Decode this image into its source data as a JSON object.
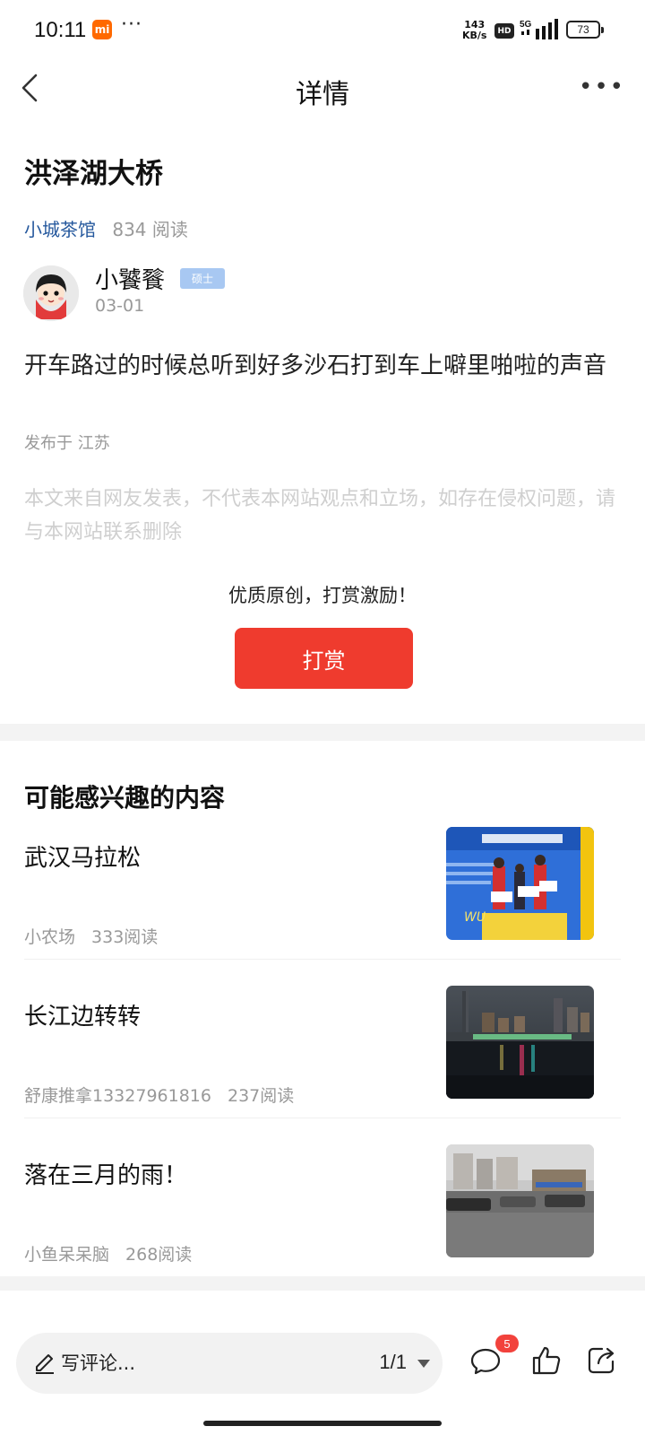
{
  "status_bar": {
    "time": "10:11",
    "mi_label": "mi",
    "dots": "···",
    "net_speed_value": "143",
    "net_speed_unit": "KB/s",
    "hd_label": "HD",
    "network": "5G",
    "battery": "73"
  },
  "header": {
    "title": "详情"
  },
  "article": {
    "title": "洪泽湖大桥",
    "forum": "小城茶馆",
    "reads": "834 阅读",
    "author": {
      "name": "小饕餮",
      "badge": "硕士",
      "date": "03-01"
    },
    "body": "开车路过的时候总听到好多沙石打到车上噼里啪啦的声音",
    "location": "发布于 江苏",
    "disclaimer": "本文来自网友发表，不代表本网站观点和立场，如存在侵权问题，请与本网站联系删除"
  },
  "reward": {
    "prompt": "优质原创，打赏激励！",
    "button_label": "打赏"
  },
  "recommendations": {
    "header": "可能感兴趣的内容",
    "items": [
      {
        "title": "武汉马拉松",
        "source": "小农场",
        "reads": "333阅读",
        "thumb": "marathon-podium-photo"
      },
      {
        "title": "长江边转转",
        "source": "舒康推拿13327961816",
        "reads": "237阅读",
        "thumb": "river-night-photo"
      },
      {
        "title": "落在三月的雨！",
        "source": "小鱼呆呆脑",
        "reads": "268阅读",
        "thumb": "rainy-street-photo"
      }
    ]
  },
  "bottom_bar": {
    "comment_placeholder": "写评论...",
    "page_indicator": "1/1",
    "comment_count": "5"
  },
  "colors": {
    "accent_red": "#ef3b2e",
    "forum_blue": "#25589d",
    "badge_blue": "#a8c8f2"
  }
}
